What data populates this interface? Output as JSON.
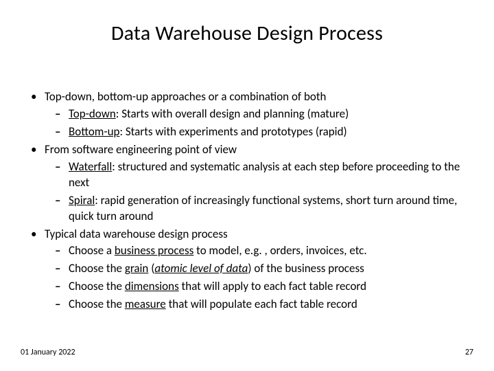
{
  "title": "Data Warehouse Design Process",
  "bullets": {
    "b1": "Top-down, bottom-up approaches or a combination of both",
    "b1_1_a": "Top-down",
    "b1_1_b": ": Starts with overall design and planning (mature)",
    "b1_2_a": "Bottom-up",
    "b1_2_b": ": Starts with experiments and prototypes (rapid)",
    "b2": "From software engineering point of view",
    "b2_1_a": "Waterfall",
    "b2_1_b": ": structured and systematic analysis at each step before proceeding to the next",
    "b2_2_a": "Spiral",
    "b2_2_b": ":  rapid generation of increasingly functional systems, short turn around time, quick turn around",
    "b3": "Typical data warehouse design process",
    "b3_1_a": "Choose a ",
    "b3_1_b": "business process",
    "b3_1_c": " to model, e.g. , orders, invoices, etc.",
    "b3_2_a": "Choose the ",
    "b3_2_b": "grain",
    "b3_2_c": " (",
    "b3_2_d": "atomic level of data",
    "b3_2_e": ") of the business process",
    "b3_3_a": "Choose the ",
    "b3_3_b": "dimensions",
    "b3_3_c": " that will apply to each fact table record",
    "b3_4_a": "Choose the ",
    "b3_4_b": "measure",
    "b3_4_c": " that will populate each fact table record"
  },
  "footer": {
    "date": "01 January 2022",
    "page": "27"
  }
}
